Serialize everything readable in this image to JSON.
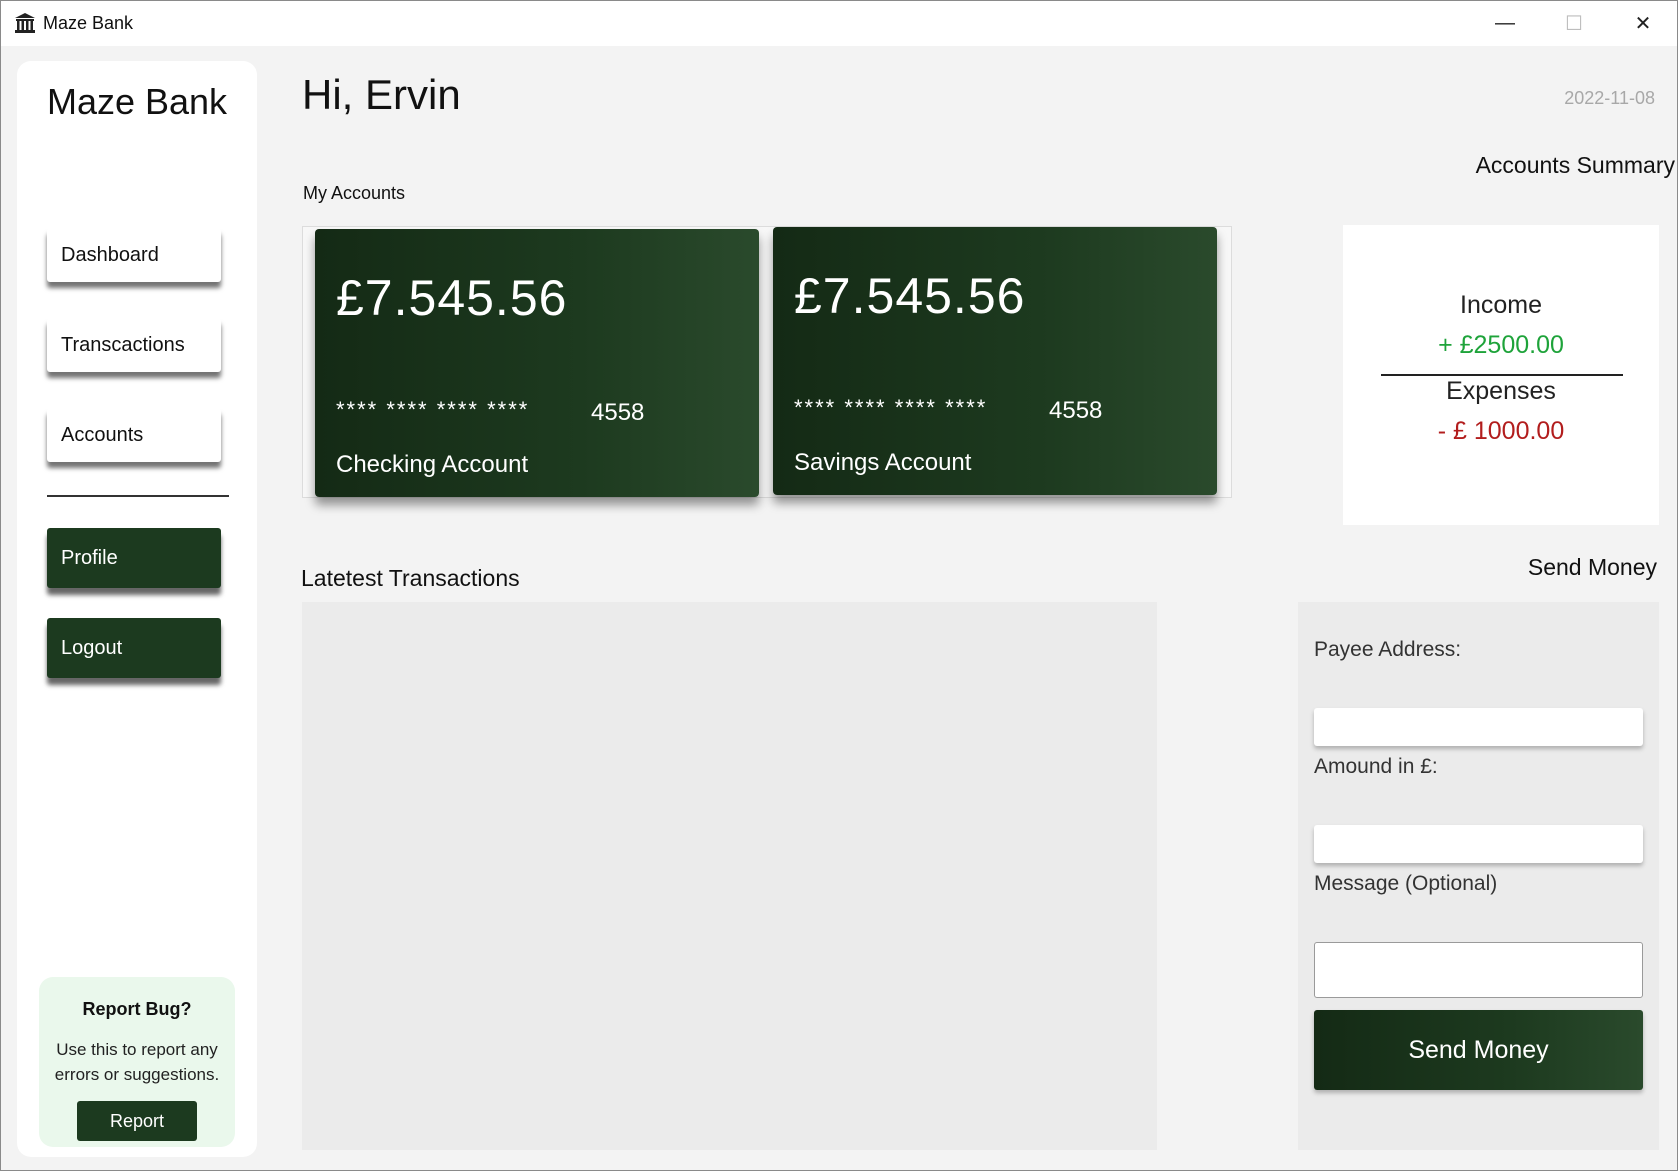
{
  "window": {
    "title": "Maze Bank",
    "icon": "bank-icon",
    "controls": {
      "minimize": "—",
      "maximize": "☐",
      "close": "✕"
    }
  },
  "sidebar": {
    "brand": "Maze Bank",
    "nav": [
      {
        "label": "Dashboard"
      },
      {
        "label": "Transcactions"
      },
      {
        "label": "Accounts"
      },
      {
        "label": "Profile"
      },
      {
        "label": "Logout"
      }
    ],
    "report": {
      "title": "Report Bug?",
      "text": "Use this to report any errors or suggestions.",
      "button": "Report"
    }
  },
  "main": {
    "greeting": "Hi, Ervin",
    "date": "2022-11-08",
    "my_accounts_label": "My  Accounts",
    "accounts": [
      {
        "balance": "£7.545.56",
        "mask": "**** **** **** ****",
        "last4": "4558",
        "type": "Checking Account"
      },
      {
        "balance": "£7.545.56",
        "mask": "**** **** **** ****",
        "last4": "4558",
        "type": "Savings Account"
      }
    ],
    "summary": {
      "title": "Accounts Summary",
      "income_label": "Income",
      "income_value": "+ £2500.00",
      "expenses_label": "Expenses",
      "expenses_value": "- £ 1000.00"
    },
    "latest_transactions_title": "Latetest Transactions",
    "send_money": {
      "title": "Send Money",
      "payee_label": "Payee Address:",
      "payee_value": "",
      "amount_label": "Amound in £:",
      "amount_value": "",
      "message_label": "Message (Optional)",
      "message_value": "",
      "button": "Send Money"
    }
  },
  "colors": {
    "accent_dark_green": "#1c3a1f",
    "income_green": "#1ea33a",
    "expense_red": "#b21d1d",
    "report_bg": "#eaf8ec"
  }
}
